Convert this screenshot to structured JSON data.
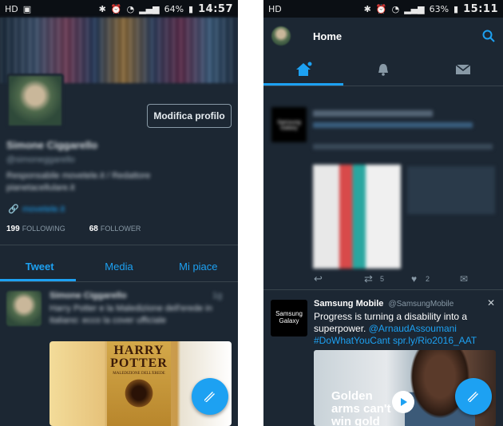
{
  "left": {
    "status": {
      "battery": "64%",
      "time": "14:57"
    },
    "profile": {
      "edit_button": "Modifica profilo",
      "name": "Simone Ciggarello",
      "handle": "@simoneggarello",
      "bio_line1": "Responsabile movetele.it  /  Redattore",
      "bio_line2": "pianetacellulare.it",
      "link": "movetele.it",
      "following_count": "199",
      "following_label": "FOLLOWING",
      "followers_count": "68",
      "followers_label": "FOLLOWER"
    },
    "tabs": [
      {
        "label": "Tweet"
      },
      {
        "label": "Media"
      },
      {
        "label": "Mi piace"
      }
    ],
    "tweet": {
      "author": "Simone Ciggarello",
      "time": "1g",
      "text1": "Harry Potter e la Maledizione dell'erede in",
      "text2": "italiano: ecco la cover ufficiale",
      "book_title": "HARRY POTTER",
      "book_subtitle": "MALEDIZIONE DELL'EREDE"
    }
  },
  "right": {
    "status": {
      "battery": "63%",
      "time": "15:11"
    },
    "appbar": {
      "title": "Home"
    },
    "blurred_tweet": {
      "source_label": "Samsung Galaxy",
      "retweet_count": "5",
      "like_count": "2"
    },
    "promoted_tweet": {
      "name": "Samsung Mobile",
      "handle": "@SamsungMobile",
      "avatar_label": "Samsung Galaxy",
      "text": "Progress is turning a disability into a superpower.",
      "mention": "@ArnaudAssoumani",
      "hashtag_link": "#DoWhatYouCant spr.ly/Rio2016_AAT",
      "media_text": "Golden arms can't win gold"
    }
  },
  "colors": {
    "accent": "#1da1f2",
    "background": "#1c2733",
    "statusbar": "#0b0f14"
  }
}
